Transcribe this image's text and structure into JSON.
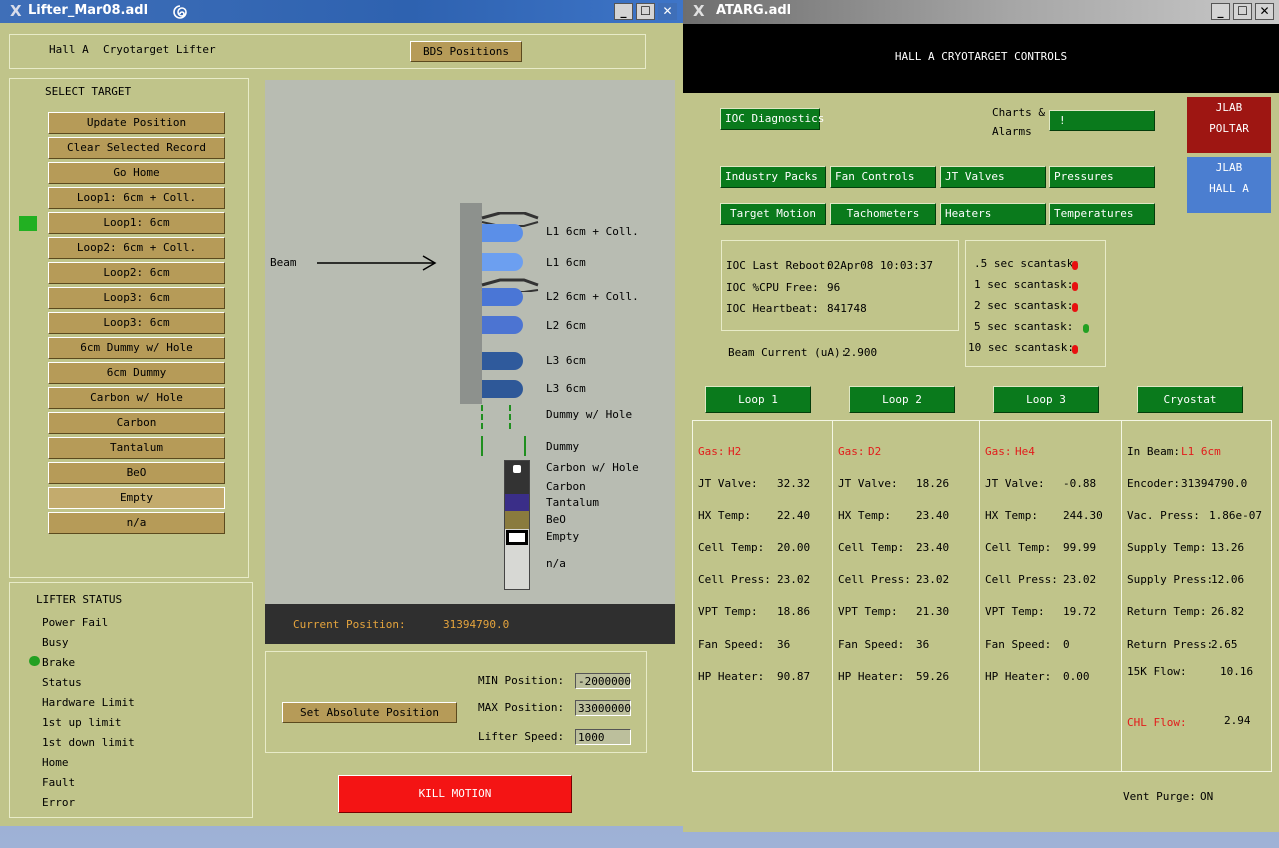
{
  "left_window": {
    "title": "Lifter_Mar08.adl",
    "header": {
      "hall": "Hall A",
      "subtitle": "Cryotarget Lifter",
      "bds_button": "BDS Positions"
    },
    "select_target": {
      "title": "SELECT TARGET",
      "buttons": [
        "Update Position",
        "Clear Selected Record",
        "Go Home",
        "Loop1: 6cm + Coll.",
        "Loop1: 6cm",
        "Loop2: 6cm + Coll.",
        "Loop2: 6cm",
        "Loop3: 6cm",
        "Loop3: 6cm",
        "6cm Dummy w/ Hole",
        "6cm Dummy",
        "Carbon w/ Hole",
        "Carbon",
        "Tantalum",
        "BeO",
        "Empty",
        "n/a"
      ]
    },
    "diagram": {
      "beam_label": "Beam",
      "labels": [
        "L1 6cm + Coll.",
        "L1 6cm",
        "L2 6cm + Coll.",
        "L2 6cm",
        "L3 6cm",
        "L3 6cm",
        "Dummy w/ Hole",
        "Dummy",
        "Carbon w/ Hole",
        "Carbon",
        "Tantalum",
        "BeO",
        "Empty",
        "n/a"
      ],
      "current_position_label": "Current Position:",
      "current_position_value": "31394790.0"
    },
    "position_controls": {
      "set_button": "Set Absolute Position",
      "min_label": "MIN Position:",
      "min_value": "-2000000",
      "max_label": "MAX Position:",
      "max_value": "33000000",
      "speed_label": "Lifter Speed:",
      "speed_value": "1000"
    },
    "lifter_status": {
      "title": "LIFTER STATUS",
      "items": [
        "Power Fail",
        "Busy",
        "Brake",
        "Status",
        "Hardware Limit",
        "1st up limit",
        "1st down limit",
        "Home",
        "Fault",
        "Error"
      ]
    },
    "kill_button": "KILL MOTION"
  },
  "right_window": {
    "title": "ATARG.adl",
    "header": "HALL A CRYOTARGET CONTROLS",
    "ioc_diagnostics": "IOC Diagnostics",
    "charts_label_1": "Charts &",
    "charts_label_2": "Alarms",
    "charts_button": "!",
    "jlab_poltar_1": "JLAB",
    "jlab_poltar_2": "POLTAR",
    "jlab_halla_1": "JLAB",
    "jlab_halla_2": "HALL A",
    "buttons_row1": [
      "Industry Packs",
      "Fan Controls",
      "JT Valves",
      "Pressures"
    ],
    "buttons_row2": [
      "Target Motion",
      "Tachometers",
      "Heaters",
      "Temperatures"
    ],
    "ioc": {
      "reboot_label": "IOC Last Reboot:",
      "reboot_value": "02Apr08 10:03:37",
      "cpu_label": "IOC %CPU Free:",
      "cpu_value": "96",
      "heartbeat_label": "IOC Heartbeat:",
      "heartbeat_value": "841748"
    },
    "beam_current_label": "Beam Current (uA):",
    "beam_current_value": "2.900",
    "scantasks": [
      ".5 sec scantask:",
      "1 sec scantask:",
      "2 sec scantask:",
      "5 sec scantask:",
      "10 sec scantask:"
    ],
    "loop_buttons": [
      "Loop 1",
      "Loop 2",
      "Loop 3",
      "Cryostat"
    ],
    "row_labels": [
      "JT Valve:",
      "HX Temp:",
      "Cell Temp:",
      "Cell Press:",
      "VPT Temp:",
      "Fan Speed:",
      "HP Heater:"
    ],
    "loops": [
      {
        "gas_label": "Gas:",
        "gas": "H2",
        "values": [
          "32.32",
          "22.40",
          "20.00",
          "23.02",
          "18.86",
          "36",
          "90.87"
        ]
      },
      {
        "gas_label": "Gas:",
        "gas": "D2",
        "values": [
          "18.26",
          "23.40",
          "23.40",
          "23.02",
          "21.30",
          "36",
          "59.26"
        ]
      },
      {
        "gas_label": "Gas:",
        "gas": "He4",
        "values": [
          "-0.88",
          "244.30",
          "99.99",
          "23.02",
          "19.72",
          "0",
          "0.00"
        ]
      }
    ],
    "cryostat": {
      "in_beam_label": "In Beam:",
      "in_beam_value": "L1 6cm",
      "encoder_label": "Encoder:",
      "encoder_value": "31394790.0",
      "vac_label": "Vac. Press:",
      "vac_value": "1.86e-07",
      "supply_temp_label": "Supply Temp:",
      "supply_temp_value": "13.26",
      "supply_press_label": "Supply Press:",
      "supply_press_value": "12.06",
      "return_temp_label": "Return Temp:",
      "return_temp_value": "26.82",
      "return_press_label": "Return Press:",
      "return_press_value": "2.65",
      "flow15_label": "15K Flow:",
      "flow15_value": "10.16",
      "chl_label": "CHL Flow:",
      "chl_value": "2.94"
    },
    "vent_purge_label": "Vent Purge:",
    "vent_purge_value": "ON"
  }
}
